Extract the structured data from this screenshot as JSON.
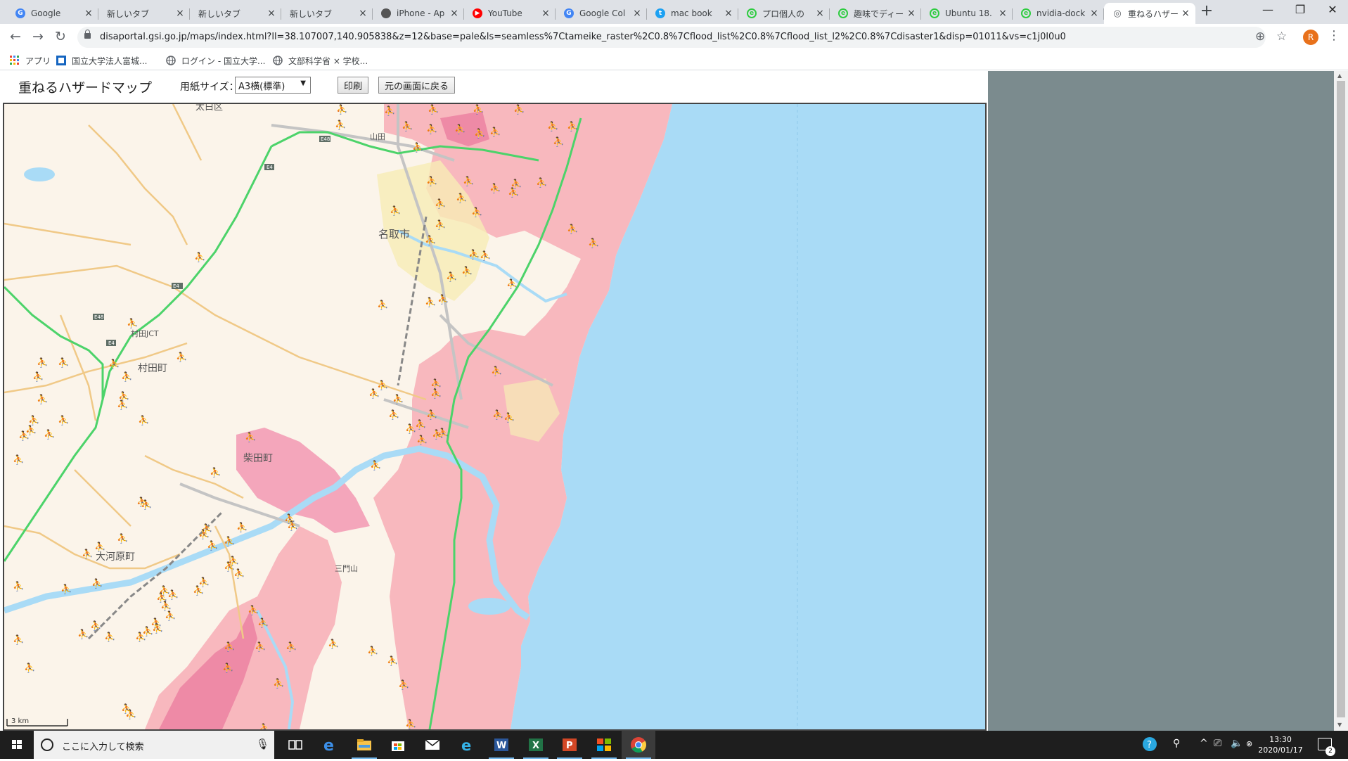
{
  "browser": {
    "tabs": [
      {
        "title": "Google",
        "icon": "google-g",
        "color": "#4285f4",
        "active": false
      },
      {
        "title": "新しいタブ",
        "icon": "none",
        "color": "",
        "active": false
      },
      {
        "title": "新しいタブ",
        "icon": "none",
        "color": "",
        "active": false
      },
      {
        "title": "新しいタブ",
        "icon": "none",
        "color": "",
        "active": false
      },
      {
        "title": "iPhone - Ap",
        "icon": "apple",
        "color": "#555555",
        "active": false
      },
      {
        "title": "YouTube",
        "icon": "youtube",
        "color": "#ff0000",
        "active": false
      },
      {
        "title": "Google Col",
        "icon": "google-g",
        "color": "#4285f4",
        "active": false
      },
      {
        "title": "mac book",
        "icon": "twitter-bird",
        "color": "#1da1f2",
        "active": false
      },
      {
        "title": "プロ個人の",
        "icon": "green-circle",
        "color": "#2ecc40",
        "active": false
      },
      {
        "title": "趣味でディー",
        "icon": "green-circle",
        "color": "#2ecc40",
        "active": false
      },
      {
        "title": "Ubuntu 18.",
        "icon": "green-circle",
        "color": "#2ecc40",
        "active": false
      },
      {
        "title": "nvidia-dock",
        "icon": "green-circle",
        "color": "#2ecc40",
        "active": false
      },
      {
        "title": "重ねるハザー",
        "icon": "globe",
        "color": "#5f6368",
        "active": true
      }
    ],
    "url": "disaportal.gsi.go.jp/maps/index.html?ll=38.107007,140.905838&z=12&base=pale&ls=seamless%7Ctameike_raster%2C0.8%7Cflood_list%2C0.8%7Cflood_list_l2%2C0.8%7Cdisaster1&disp=01011&vs=c1j0l0u0",
    "profile_initial": "R",
    "bookmarks": [
      {
        "label": "アプリ",
        "icon": "apps-grid"
      },
      {
        "label": "国立大学法人富城...",
        "icon": "blue-square"
      },
      {
        "label": "ログイン - 国立大学...",
        "icon": "globe"
      },
      {
        "label": "文部科学省 × 学校...",
        "icon": "globe"
      }
    ]
  },
  "page": {
    "title": "重ねるハザードマップ",
    "paper_size_label": "用紙サイズ：",
    "paper_size_value": "A3横(標準)",
    "print_button": "印刷",
    "back_button": "元の画面に戻る"
  },
  "map": {
    "place_labels": [
      {
        "id": "natori",
        "text": "名取市"
      },
      {
        "id": "murata",
        "text": "村田町"
      },
      {
        "id": "shibata",
        "text": "柴田町"
      },
      {
        "id": "ogawara",
        "text": "大河原町"
      },
      {
        "id": "taihaku",
        "text": "太白区"
      },
      {
        "id": "yamada",
        "text": "山田"
      },
      {
        "id": "murata_jct",
        "text": "村田JCT"
      },
      {
        "id": "sanrisho",
        "text": "三門山"
      }
    ],
    "scale_label": "3 km",
    "colors": {
      "sea": "#a9dbf6",
      "flood": "#f8b8be",
      "flood_deep": "#ee8aa6",
      "land": "#fbf4ea",
      "road": "#f0c987",
      "expressway": "#4cd36a",
      "shelter": "#1a9b3a"
    }
  },
  "taskbar": {
    "search_placeholder": "ここに入力して検索",
    "apps": [
      "task-view",
      "edge",
      "file-explorer",
      "store",
      "mail",
      "ie",
      "word",
      "excel",
      "powerpoint",
      "tiles",
      "chrome"
    ],
    "time": "13:30",
    "date": "2020/01/17",
    "notification_count": "2"
  }
}
